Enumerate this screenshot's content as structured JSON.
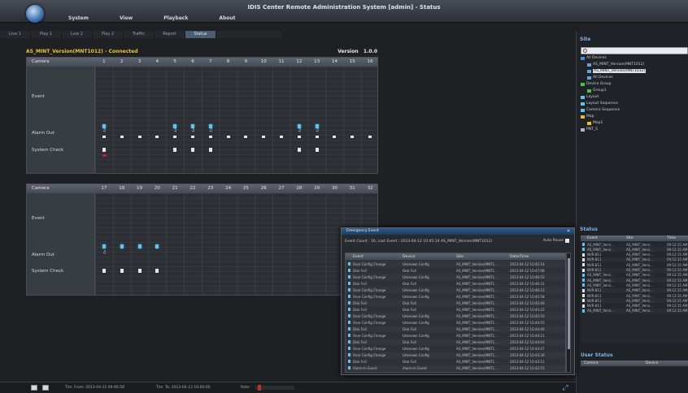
{
  "app": {
    "title": "IDIS Center Remote Administration System [admin] - Status",
    "menu": [
      "System",
      "View",
      "Playback",
      "About"
    ]
  },
  "tabs": [
    {
      "label": "Live 1",
      "active": false
    },
    {
      "label": "Play 1",
      "active": false
    },
    {
      "label": "Live 2",
      "active": false
    },
    {
      "label": "Play 2",
      "active": false
    },
    {
      "label": "Traffic",
      "active": false
    },
    {
      "label": "Report",
      "active": false
    },
    {
      "label": "Status",
      "active": true
    }
  ],
  "device": {
    "name": "AS_MINT_Version(MNT1012) - Connected",
    "version_label": "Version",
    "version": "1.0.0"
  },
  "panels": [
    {
      "header": "Camera",
      "cameras": [
        "1",
        "2",
        "3",
        "4",
        "5",
        "6",
        "7",
        "8",
        "9",
        "10",
        "11",
        "12",
        "13",
        "14",
        "15",
        "16"
      ],
      "rows": [
        {
          "label": "Event",
          "pos": 0.26
        },
        {
          "label": "Alarm Out",
          "pos": 0.6
        },
        {
          "label": "System Check",
          "pos": 0.76
        }
      ],
      "event_on": [
        1,
        5,
        6,
        7,
        12,
        13
      ],
      "alarm_on": [
        1,
        5,
        6,
        7,
        12,
        13
      ],
      "alarm_out_all": true,
      "syscheck_on": [
        1,
        5,
        6,
        7,
        12,
        13
      ],
      "syscheck_alert": [
        1
      ]
    },
    {
      "header": "Camera",
      "cameras": [
        "17",
        "18",
        "19",
        "20",
        "21",
        "22",
        "23",
        "24",
        "25",
        "26",
        "27",
        "28",
        "29",
        "30",
        "31",
        "32"
      ],
      "rows": [
        {
          "label": "Event",
          "pos": 0.22
        },
        {
          "label": "Alarm Out",
          "pos": 0.58
        },
        {
          "label": "System Check",
          "pos": 0.74
        }
      ],
      "event_on": [
        1,
        2,
        3,
        4
      ],
      "alarm_on": [
        1
      ],
      "alarm_out_all": false,
      "syscheck_on": [
        1,
        2,
        3,
        4
      ],
      "syscheck_alert": []
    }
  ],
  "sidebar": {
    "site_title": "Site",
    "search_placeholder": "",
    "tree": [
      {
        "label": "All Devices",
        "indent": 0,
        "icon": "#4a8fd0",
        "selected": false
      },
      {
        "label": "AS_MINT_Version(MNT1012)",
        "indent": 2,
        "icon": "#6aa0d8",
        "selected": false
      },
      {
        "label": "AS_MINT_Version(MNT1012)",
        "indent": 2,
        "icon": "#6aa0d8",
        "selected": true
      },
      {
        "label": "All Devices",
        "indent": 2,
        "icon": "#6aa0d8",
        "selected": false
      },
      {
        "label": "Device Group",
        "indent": 0,
        "icon": "#4ec04e",
        "selected": false
      },
      {
        "label": "Group1",
        "indent": 2,
        "icon": "#4ec04e",
        "selected": false
      },
      {
        "label": "Layout",
        "indent": 0,
        "icon": "#5fc4ef",
        "selected": false
      },
      {
        "label": "Layout Sequence",
        "indent": 0,
        "icon": "#5fc4ef",
        "selected": false
      },
      {
        "label": "Camera Sequence",
        "indent": 0,
        "icon": "#5fc4ef",
        "selected": false
      },
      {
        "label": "Map",
        "indent": 0,
        "icon": "#e8b83a",
        "selected": false
      },
      {
        "label": "Map1",
        "indent": 2,
        "icon": "#e8b83a",
        "selected": false
      },
      {
        "label": "PNT_S",
        "indent": 0,
        "icon": "#b0b6be",
        "selected": false
      }
    ],
    "status_title": "Status",
    "status_columns": [
      "Event",
      "Site",
      "Time"
    ],
    "status_rows": [
      {
        "event": "AS_MINT_Versi...",
        "site": "AS_MINT_Versi...",
        "time": "09:12:15 AM",
        "icon": "#5fc4ef"
      },
      {
        "event": "AS_MINT_Versi...",
        "site": "AS_MINT_Versi...",
        "time": "09:12:15 AM",
        "icon": "#5fc4ef"
      },
      {
        "event": "NVR-811",
        "site": "AS_MINT_Versi...",
        "time": "09:12:15 AM",
        "icon": "#e4e6ea"
      },
      {
        "event": "NVR-811",
        "site": "AS_MINT_Versi...",
        "time": "09:12:15 AM",
        "icon": "#e4e6ea"
      },
      {
        "event": "NVR-811",
        "site": "AS_MINT_Versi...",
        "time": "09:12:15 AM",
        "icon": "#e4e6ea"
      },
      {
        "event": "NVR-811",
        "site": "AS_MINT_Versi...",
        "time": "09:12:15 AM",
        "icon": "#e4e6ea"
      },
      {
        "event": "AS_MINT_Versi...",
        "site": "AS_MINT_Versi...",
        "time": "09:12:15 AM",
        "icon": "#5fc4ef"
      },
      {
        "event": "AS_MINT_Versi...",
        "site": "AS_MINT_Versi...",
        "time": "09:12:15 AM",
        "icon": "#5fc4ef"
      },
      {
        "event": "AS_MINT_Versi...",
        "site": "AS_MINT_Versi...",
        "time": "09:12:15 AM",
        "icon": "#5fc4ef"
      },
      {
        "event": "NVR-811",
        "site": "AS_MINT_Versi...",
        "time": "09:12:15 AM",
        "icon": "#e4e6ea"
      },
      {
        "event": "NVR-811",
        "site": "AS_MINT_Versi...",
        "time": "09:12:15 AM",
        "icon": "#e4e6ea"
      },
      {
        "event": "NVR-811",
        "site": "AS_MINT_Versi...",
        "time": "09:12:15 AM",
        "icon": "#e4e6ea"
      },
      {
        "event": "NVR-811",
        "site": "AS_MINT_Versi...",
        "time": "09:12:15 AM",
        "icon": "#e4e6ea"
      },
      {
        "event": "AS_MINT_Versi...",
        "site": "AS_MINT_Versi...",
        "time": "09:12:15 AM",
        "icon": "#5fc4ef"
      }
    ],
    "user_status_title": "User Status",
    "user_columns": [
      "Camera",
      "Device"
    ]
  },
  "dialog": {
    "title": "Emergency Event",
    "info": "Event Count : 16, Last Event : 2013-04-12 10:45:14 AS_MINT_Version(MNT1012)",
    "autopause_label": "Auto Pause",
    "columns": [
      "Event",
      "Device",
      "Site",
      "Date/Time"
    ],
    "rows": [
      {
        "event": "Over Config Change",
        "device": "Unknown Config",
        "site": "AS_MINT_Version(MNT1...",
        "time": "2013-04-12 10:45:14"
      },
      {
        "event": "Disk Full",
        "device": "Disk Full",
        "site": "AS_MINT_Version(MNT1...",
        "time": "2013-04-12 10:47:08"
      },
      {
        "event": "Over Config Change",
        "device": "Unknown Config",
        "site": "AS_MINT_Version(MNT1...",
        "time": "2013-04-12 10:46:52"
      },
      {
        "event": "Disk Full",
        "device": "Disk Full",
        "site": "AS_MINT_Version(MNT1...",
        "time": "2013-04-12 10:46:31"
      },
      {
        "event": "Over Config Change",
        "device": "Unknown Config",
        "site": "AS_MINT_Version(MNT1...",
        "time": "2013-04-12 10:46:12"
      },
      {
        "event": "Over Config Change",
        "device": "Unknown Config",
        "site": "AS_MINT_Version(MNT1...",
        "time": "2013-04-12 10:45:58"
      },
      {
        "event": "Disk Full",
        "device": "Disk Full",
        "site": "AS_MINT_Version(MNT1...",
        "time": "2013-04-12 10:45:40"
      },
      {
        "event": "Disk Full",
        "device": "Disk Full",
        "site": "AS_MINT_Version(MNT1...",
        "time": "2013-04-12 10:45:22"
      },
      {
        "event": "Over Config Change",
        "device": "Unknown Config",
        "site": "AS_MINT_Version(MNT1...",
        "time": "2013-04-12 10:45:10"
      },
      {
        "event": "Over Config Change",
        "device": "Unknown Config",
        "site": "AS_MINT_Version(MNT1...",
        "time": "2013-04-12 10:44:55"
      },
      {
        "event": "Disk Full",
        "device": "Disk Full",
        "site": "AS_MINT_Version(MNT1...",
        "time": "2013-04-12 10:44:40"
      },
      {
        "event": "Over Config Change",
        "device": "Unknown Config",
        "site": "AS_MINT_Version(MNT1...",
        "time": "2013-04-12 10:44:21"
      },
      {
        "event": "Disk Full",
        "device": "Disk Full",
        "site": "AS_MINT_Version(MNT1...",
        "time": "2013-04-12 10:44:03"
      },
      {
        "event": "Over Config Change",
        "device": "Unknown Config",
        "site": "AS_MINT_Version(MNT1...",
        "time": "2013-04-12 10:43:47"
      },
      {
        "event": "Over Config Change",
        "device": "Unknown Config",
        "site": "AS_MINT_Version(MNT1...",
        "time": "2013-04-12 10:43:30"
      },
      {
        "event": "Disk Full",
        "device": "Disk Full",
        "site": "AS_MINT_Version(MNT1...",
        "time": "2013-04-12 10:43:12"
      },
      {
        "event": "Alarm-In Event",
        "device": "Alarm-In Event",
        "site": "AS_MINT_Version(MNT1...",
        "time": "2013-04-12 10:42:55"
      }
    ],
    "scroll_fraction": 0.77
  },
  "statusbar": {
    "from": "Tim. From: 2013-04-12 09:46:58",
    "to": "Tim. To: 2013-04-12 10:00:00",
    "rate": "Rate:",
    "rate_fraction": 0.06
  }
}
